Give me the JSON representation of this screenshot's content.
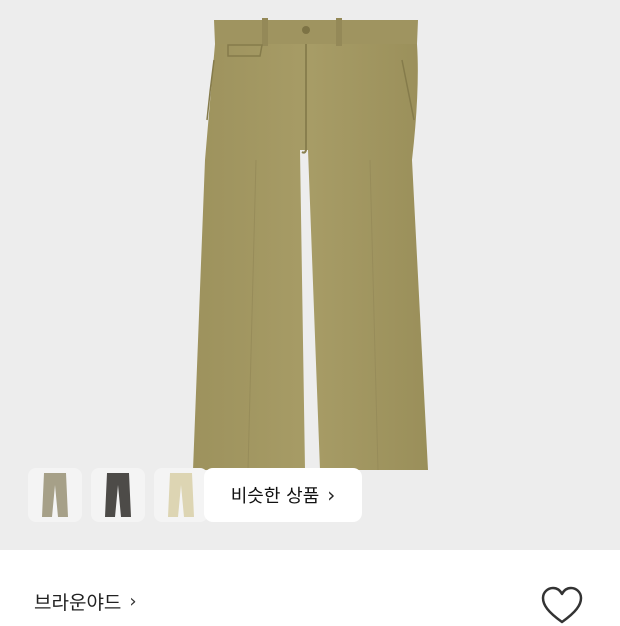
{
  "product": {
    "image_icon": "khaki-wide-pants-image",
    "colors": [
      "#a6a088",
      "#4d4b48",
      "#ddd5b3"
    ]
  },
  "color_thumbnails": [
    {
      "color": "#a6a088",
      "icon": "pants-icon"
    },
    {
      "color": "#4d4b48",
      "icon": "pants-icon"
    },
    {
      "color": "#ddd5b3",
      "icon": "pants-icon"
    }
  ],
  "similar_products": {
    "label": "비슷한 상품",
    "chevron": "›"
  },
  "brand": {
    "name": "브라운야드",
    "chevron": "›"
  },
  "like": {
    "icon": "heart-outline-icon"
  }
}
